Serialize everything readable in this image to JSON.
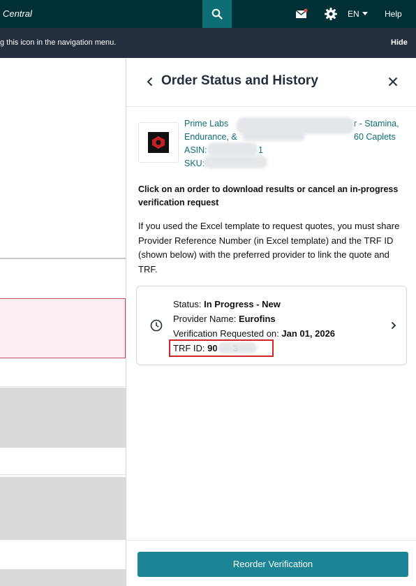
{
  "topbar": {
    "brand": "Central",
    "search_icon": "search-icon",
    "mail_icon": "mail-icon",
    "settings_icon": "gear-icon",
    "language": "EN",
    "help": "Help",
    "bg_color": "#002f36",
    "search_btn_color": "#0e6e76"
  },
  "infobar": {
    "text": "g this icon in the navigation menu.",
    "hide": "Hide"
  },
  "panel": {
    "title": "Order Status and History",
    "product": {
      "line1": "Prime Labs",
      "line1_tail": "r - Stamina,",
      "line2": "Endurance, &",
      "line2_tail": "60 Caplets",
      "asin_label": "ASIN:",
      "asin_tail": "1",
      "sku_label": "SKU:"
    },
    "instructions": "Click on an order to download results or cancel an in-progress verification request",
    "note": "If you used the Excel template to request quotes, you must share Provider Reference Number (in Excel template) and the TRF ID (shown below) with the preferred provider to link the quote and TRF.",
    "order": {
      "status_label": "Status:",
      "status_value": "In Progress - New",
      "provider_label": "Provider Name:",
      "provider_value": "Eurofins",
      "requested_label": "Verification Requested on:",
      "requested_value": "Jan 01, 2026",
      "trf_label": "TRF ID:",
      "trf_value_start": "90",
      "trf_value_end": "3"
    },
    "reorder_button": "Reorder Verification",
    "accent_color": "#1b8596",
    "link_color": "#0e6e76",
    "highlight_color": "#d2232a"
  }
}
